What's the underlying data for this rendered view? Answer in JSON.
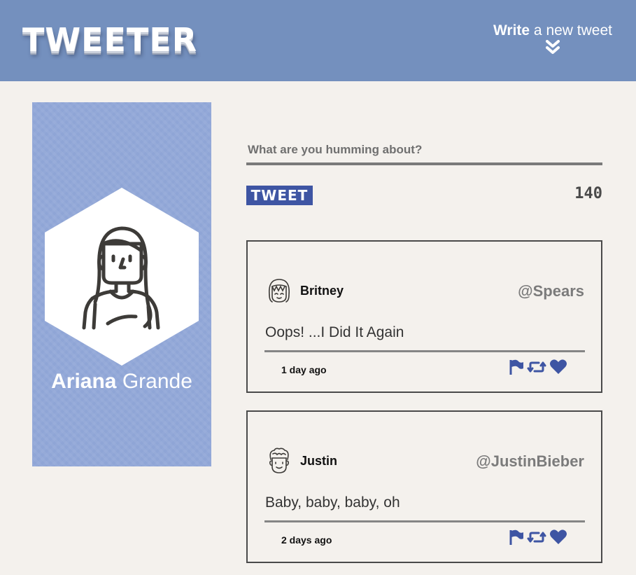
{
  "header": {
    "logo": "TWEETER",
    "write_bold": "Write",
    "write_rest": " a new tweet"
  },
  "profile": {
    "first_name": "Ariana",
    "last_name": " Grande",
    "avatar_icon": "woman-avatar-icon"
  },
  "composer": {
    "placeholder": "What are you humming about?",
    "tweet_label": "TWEET",
    "counter": "140"
  },
  "tweets": [
    {
      "name": "Britney",
      "handle": "@Spears",
      "text": "Oops! ...I Did It Again",
      "time": "1 day ago",
      "avatar_icon": "girl-avatar-icon"
    },
    {
      "name": "Justin",
      "handle": "@JustinBieber",
      "text": "Baby, baby, baby, oh",
      "time": "2 days ago",
      "avatar_icon": "boy-avatar-icon"
    }
  ],
  "colors": {
    "header_bg": "#7490be",
    "profile_bg": "#8fa5d6",
    "accent": "#3e55a3",
    "page_bg": "#f4f1ed"
  }
}
